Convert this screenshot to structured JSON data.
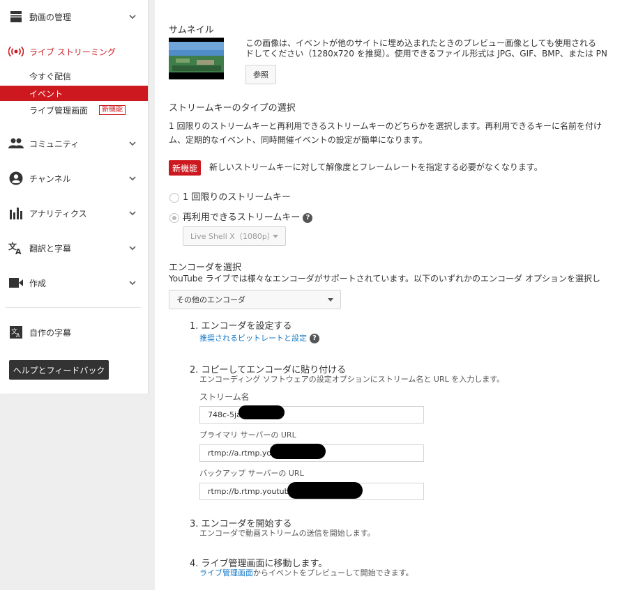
{
  "sidebar": {
    "items": [
      {
        "label": "動画の管理",
        "icon": "video-manager-icon"
      },
      {
        "label": "ライブ ストリーミング",
        "icon": "live-icon"
      },
      {
        "label": "コミュニティ",
        "icon": "community-icon"
      },
      {
        "label": "チャンネル",
        "icon": "channel-icon"
      },
      {
        "label": "アナリティクス",
        "icon": "analytics-icon"
      },
      {
        "label": "翻訳と字幕",
        "icon": "translate-icon"
      },
      {
        "label": "作成",
        "icon": "create-icon"
      }
    ],
    "live_sub": [
      {
        "label": "今すぐ配信"
      },
      {
        "label": "イベント"
      },
      {
        "label": "ライブ管理画面",
        "badge": "新機能"
      }
    ],
    "own_subtitles": "自作の字幕",
    "help_label": "ヘルプとフィードバック",
    "accent": "#cc181e"
  },
  "main": {
    "thumbnail": {
      "heading": "サムネイル",
      "desc_line1": "この画像は、イベントが他のサイトに埋め込まれたときのプレビュー画像としても使用される",
      "desc_line2": "ドしてください（1280x720 を推奨）。使用できるファイル形式は JPG、GIF、BMP、または PN",
      "browse_label": "参照"
    },
    "streamkey": {
      "heading": "ストリームキーのタイプの選択",
      "desc_line1": "1 回限りのストリームキーと再利用できるストリームキーのどちらかを選択します。再利用できるキーに名前を付け",
      "desc_line2": "ム、定期的なイベント、同時開催イベントの設定が簡単になります。",
      "new_badge": "新機能",
      "new_text": "新しいストリームキーに対して解像度とフレームレートを指定する必要がなくなります。",
      "option_once": "1 回限りのストリームキー",
      "option_reuse": "再利用できるストリームキー",
      "reuse_select": "Live Shell X（1080p）"
    },
    "encoder": {
      "heading": "エンコーダを選択",
      "desc": "YouTube ライブでは様々なエンコーダがサポートされています。以下のいずれかのエンコーダ オプションを選択し",
      "select_value": "その他のエンコーダ",
      "steps": [
        {
          "num": "1.",
          "title": "エンコーダを設定する",
          "link": "推奨されるビットレートと設定"
        },
        {
          "num": "2.",
          "title": "コピーしてエンコーダに貼り付ける",
          "desc": "エンコーディング ソフトウェアの設定オプションにストリーム名と URL を入力します。"
        },
        {
          "num": "3.",
          "title": "エンコーダを開始する",
          "desc": "エンコーダで動画ストリームの送信を開始します。"
        },
        {
          "num": "4.",
          "title": "ライブ管理画面に移動します。",
          "link": "ライブ管理画面",
          "desc_rest": "からイベントをプレビューして開始できます。"
        }
      ],
      "fields": [
        {
          "label": "ストリーム名",
          "value": "748c-5ja"
        },
        {
          "label": "プライマリ サーバーの URL",
          "value": "rtmp://a.rtmp.yout"
        },
        {
          "label": "バックアップ サーバーの URL",
          "value": "rtmp://b.rtmp.youtube.c"
        }
      ]
    }
  }
}
